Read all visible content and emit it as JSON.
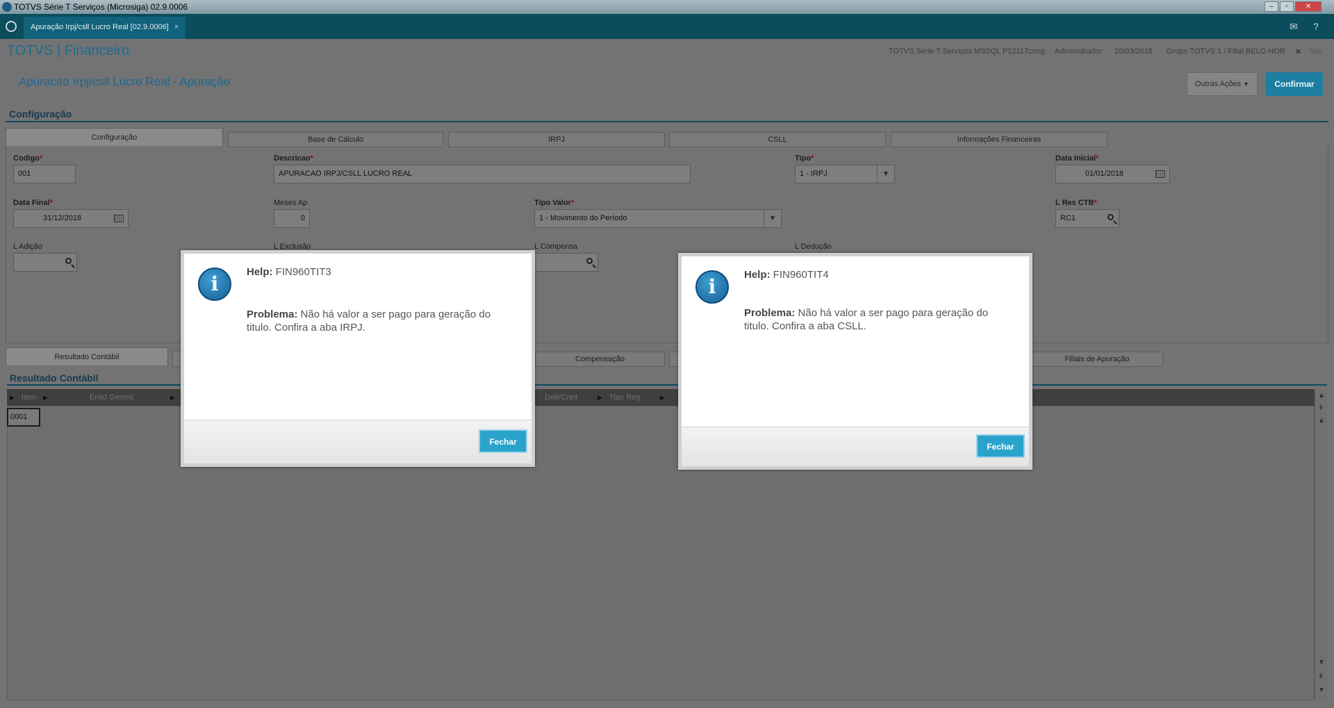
{
  "window": {
    "title": "TOTVS Série T Serviços (Microsiga) 02.9.0006"
  },
  "apptab": {
    "label": "Apuração Irpj/csll Lucro Real [02.9.0006]",
    "close": "×"
  },
  "header": {
    "brand": "TOTVS | Financeiro",
    "environment": "TOTVS Série T Serviços MSSQL P12117cong",
    "user": "Administrador",
    "date": "20/03/2018",
    "branch": "Grupo TOTVS 1 / Filial BELO HOR",
    "exit": "Sair"
  },
  "page": {
    "subtitle": "Apuracao Irpj/csll Lucro Real - Apuração",
    "outras_acoes": "Outras Ações",
    "confirmar": "Confirmar"
  },
  "config": {
    "section_title": "Configuração",
    "tabs": [
      "Configuração",
      "Base de Cálculo",
      "IRPJ",
      "CSLL",
      "Informações Financeiras"
    ],
    "fields": {
      "codigo": {
        "label": "Codigo",
        "value": "001"
      },
      "descricao": {
        "label": "Descricao",
        "value": "APURACAO IRPJ/CSLL LUCRO REAL"
      },
      "tipo": {
        "label": "Tipo",
        "value": "1 - IRPJ"
      },
      "data_inicial": {
        "label": "Data Inicial",
        "value": "01/01/2018"
      },
      "data_final": {
        "label": "Data Final",
        "value": "31/12/2018"
      },
      "meses_ap": {
        "label": "Meses Ap",
        "value": "0"
      },
      "tipo_valor": {
        "label": "Tipo Valor",
        "value": "1 - Movimento do Período"
      },
      "l_res_ctb": {
        "label": "L Res CTB",
        "value": "RC1"
      },
      "l_adicao": {
        "label": "L Adição"
      },
      "l_exclusao": {
        "label": "L Exclusão"
      },
      "l_compensa": {
        "label": "L Compensa"
      },
      "l_deducao": {
        "label": "L Dedução"
      }
    }
  },
  "result": {
    "tabs": [
      "Resultado Contábil",
      "Compensação",
      "Filiais de Apuração"
    ],
    "section_title": "Resultado Contábil",
    "columns": [
      "Item",
      "Entid Gerenc",
      "Deb/Cred",
      "Tipo Reg"
    ],
    "rows": [
      [
        "0001"
      ]
    ]
  },
  "dialogs": [
    {
      "help_label": "Help:",
      "help_code": "FIN960TIT3",
      "problem_label": "Problema:",
      "problem_text": "Não há valor a ser pago para geração do titulo. Confira a aba IRPJ.",
      "button": "Fechar"
    },
    {
      "help_label": "Help:",
      "help_code": "FIN960TIT4",
      "problem_label": "Problema:",
      "problem_text": "Não há valor a ser pago para geração do titulo. Confira a aba CSLL.",
      "button": "Fechar"
    }
  ]
}
